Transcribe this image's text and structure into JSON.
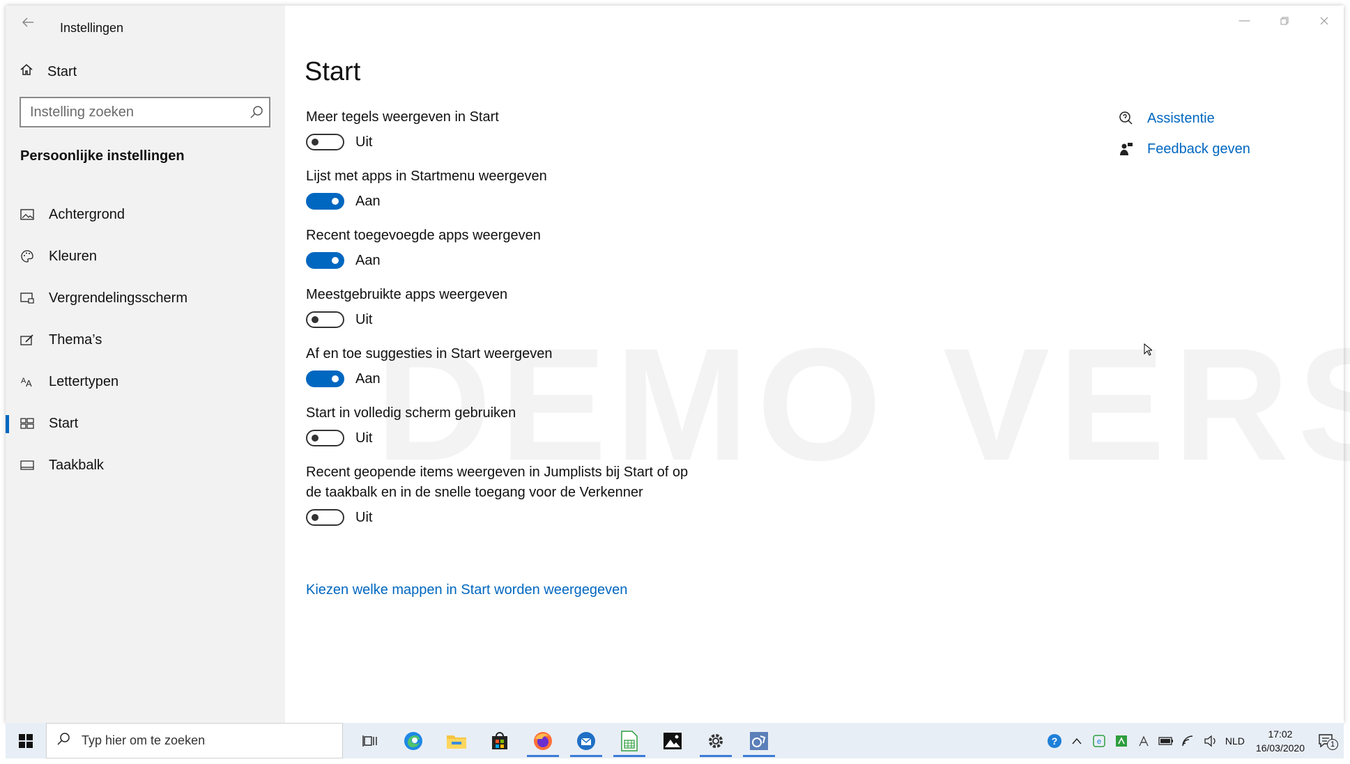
{
  "window": {
    "title": "Instellingen",
    "controls": [
      "minimize",
      "restore",
      "close"
    ]
  },
  "sidebar": {
    "home_label": "Start",
    "search_placeholder": "Instelling zoeken",
    "section_heading": "Persoonlijke instellingen",
    "items": [
      {
        "label": "Achtergrond",
        "icon": "picture-icon",
        "active": false
      },
      {
        "label": "Kleuren",
        "icon": "palette-icon",
        "active": false
      },
      {
        "label": "Vergrendelingsscherm",
        "icon": "lock-screen-icon",
        "active": false
      },
      {
        "label": "Thema’s",
        "icon": "brush-icon",
        "active": false
      },
      {
        "label": "Lettertypen",
        "icon": "font-icon",
        "active": false
      },
      {
        "label": "Start",
        "icon": "start-tiles-icon",
        "active": true
      },
      {
        "label": "Taakbalk",
        "icon": "taskbar-icon",
        "active": false
      }
    ]
  },
  "main": {
    "title": "Start",
    "settings": [
      {
        "label": "Meer tegels weergeven in Start",
        "on": false,
        "state": "Uit"
      },
      {
        "label": "Lijst met apps in Startmenu weergeven",
        "on": true,
        "state": "Aan"
      },
      {
        "label": "Recent toegevoegde apps weergeven",
        "on": true,
        "state": "Aan"
      },
      {
        "label": "Meestgebruikte apps weergeven",
        "on": false,
        "state": "Uit"
      },
      {
        "label": "Af en toe suggesties in Start weergeven",
        "on": true,
        "state": "Aan"
      },
      {
        "label": "Start in volledig scherm gebruiken",
        "on": false,
        "state": "Uit"
      },
      {
        "label": "Recent geopende items weergeven in Jumplists bij Start of op de taakbalk en in de snelle toegang voor de Verkenner",
        "on": false,
        "state": "Uit"
      }
    ],
    "folders_link": "Kiezen welke mappen in Start worden weergegeven",
    "help_links": [
      {
        "label": "Assistentie",
        "icon": "assistance-icon"
      },
      {
        "label": "Feedback geven",
        "icon": "feedback-icon"
      }
    ],
    "watermark": "DEMO VERSION"
  },
  "taskbar": {
    "search_placeholder": "Typ hier om te zoeken",
    "apps": [
      {
        "name": "task-view",
        "running": false
      },
      {
        "name": "edge",
        "running": false
      },
      {
        "name": "file-explorer",
        "running": false
      },
      {
        "name": "store",
        "running": false
      },
      {
        "name": "firefox",
        "running": true
      },
      {
        "name": "thunderbird",
        "running": true
      },
      {
        "name": "calc-spreadsheet",
        "running": true
      },
      {
        "name": "photos",
        "running": false
      },
      {
        "name": "settings",
        "running": true
      },
      {
        "name": "demo-app",
        "running": true
      }
    ],
    "language": "NLD",
    "time": "17:02",
    "date": "16/03/2020",
    "notification_count": "1"
  },
  "colors": {
    "accent": "#0067c0",
    "sidebar_bg": "#f2f2f2",
    "taskbar_bg": "#e8eef6"
  }
}
